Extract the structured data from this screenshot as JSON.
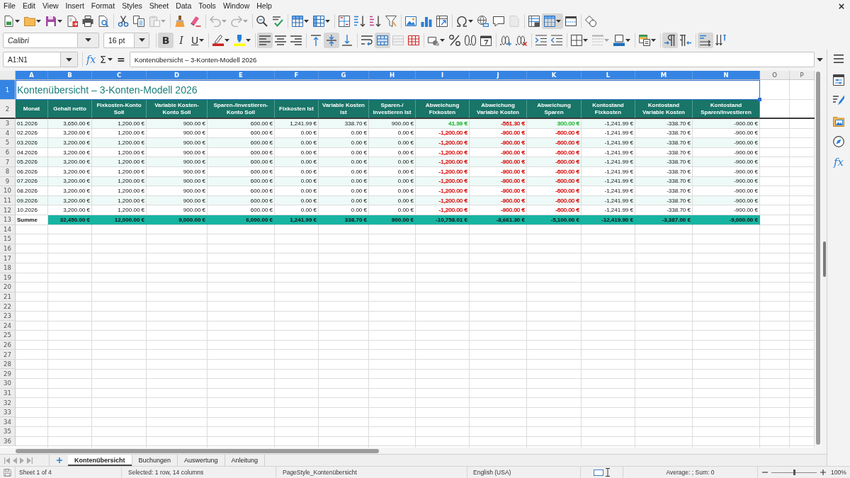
{
  "menu_bar": {
    "items": [
      "File",
      "Edit",
      "View",
      "Insert",
      "Format",
      "Styles",
      "Sheet",
      "Data",
      "Tools",
      "Window",
      "Help"
    ]
  },
  "standard_toolbar": {
    "buttons": [
      {
        "pressed": false,
        "disabled": false
      },
      {
        "pressed": false,
        "disabled": false
      },
      {
        "pressed": false,
        "disabled": false
      },
      {
        "pressed": false,
        "disabled": false
      },
      {
        "pressed": false,
        "disabled": false
      },
      {
        "pressed": false,
        "disabled": false
      },
      {
        "pressed": false,
        "disabled": false
      },
      {
        "pressed": false,
        "disabled": false
      },
      {
        "pressed": false,
        "disabled": true
      },
      {
        "pressed": false,
        "disabled": false
      },
      {
        "pressed": false,
        "disabled": false
      },
      {
        "pressed": false,
        "disabled": true
      },
      {
        "pressed": false,
        "disabled": true
      },
      {
        "pressed": false,
        "disabled": false
      },
      {
        "pressed": false,
        "disabled": false
      },
      {
        "pressed": false,
        "disabled": false
      },
      {
        "pressed": false,
        "disabled": false
      },
      {
        "pressed": false,
        "disabled": false
      },
      {
        "pressed": false,
        "disabled": false
      },
      {
        "pressed": false,
        "disabled": false
      },
      {
        "pressed": false,
        "disabled": false
      },
      {
        "pressed": false,
        "disabled": false
      },
      {
        "pressed": false,
        "disabled": false
      },
      {
        "pressed": false,
        "disabled": false
      },
      {
        "pressed": false,
        "disabled": false
      },
      {
        "pressed": false,
        "disabled": false
      },
      {
        "pressed": false,
        "disabled": false
      },
      {
        "pressed": false,
        "disabled": true
      },
      {
        "pressed": false,
        "disabled": false
      },
      {
        "pressed": true,
        "disabled": false
      },
      {
        "pressed": false,
        "disabled": false
      },
      {
        "pressed": false,
        "disabled": false
      }
    ]
  },
  "formatting_toolbar": {
    "font_name": "Calibri",
    "font_size": "16 pt",
    "buttons": [
      {
        "label": "B",
        "pressed": true,
        "disabled": false
      },
      {
        "label": "I",
        "pressed": false,
        "disabled": false
      },
      {
        "label": "U",
        "pressed": false,
        "disabled": false
      },
      {
        "pressed": false,
        "disabled": false
      },
      {
        "pressed": false,
        "disabled": false
      },
      {
        "pressed": true,
        "disabled": false
      },
      {
        "pressed": false,
        "disabled": false
      },
      {
        "pressed": false,
        "disabled": false
      },
      {
        "pressed": false,
        "disabled": false
      },
      {
        "pressed": true,
        "disabled": false
      },
      {
        "pressed": false,
        "disabled": false
      },
      {
        "pressed": false,
        "disabled": false
      },
      {
        "pressed": true,
        "disabled": false
      },
      {
        "pressed": false,
        "disabled": true
      },
      {
        "pressed": false,
        "disabled": false
      },
      {
        "pressed": false,
        "disabled": false
      },
      {
        "pressed": false,
        "disabled": false
      },
      {
        "pressed": false,
        "disabled": false
      },
      {
        "pressed": false,
        "disabled": false
      },
      {
        "pressed": false,
        "disabled": false
      },
      {
        "pressed": false,
        "disabled": false
      },
      {
        "pressed": false,
        "disabled": false
      },
      {
        "pressed": false,
        "disabled": false
      },
      {
        "pressed": false,
        "disabled": false
      },
      {
        "pressed": false,
        "disabled": true
      },
      {
        "pressed": false,
        "disabled": false
      },
      {
        "pressed": false,
        "disabled": false
      },
      {
        "pressed": true,
        "disabled": false
      },
      {
        "pressed": false,
        "disabled": false
      },
      {
        "pressed": true,
        "disabled": false
      },
      {
        "pressed": false,
        "disabled": false
      }
    ]
  },
  "formula_bar": {
    "name_box": "A1:N1",
    "function_wizard": "fx",
    "sum": "Σ",
    "formula": "=",
    "content": "Kontenübersicht – 3-Konten-Modell 2026"
  },
  "sheet": {
    "columns": [
      {
        "label": "A",
        "selected": true
      },
      {
        "label": "B",
        "selected": true
      },
      {
        "label": "C",
        "selected": true
      },
      {
        "label": "D",
        "selected": true
      },
      {
        "label": "E",
        "selected": true
      },
      {
        "label": "F",
        "selected": true
      },
      {
        "label": "G",
        "selected": true
      },
      {
        "label": "H",
        "selected": true
      },
      {
        "label": "I",
        "selected": true
      },
      {
        "label": "J",
        "selected": true
      },
      {
        "label": "K",
        "selected": true
      },
      {
        "label": "L",
        "selected": true
      },
      {
        "label": "M",
        "selected": true
      },
      {
        "label": "N",
        "selected": true
      },
      {
        "label": "O",
        "selected": false
      },
      {
        "label": "P",
        "selected": false
      }
    ],
    "rows": [
      {
        "label": "1",
        "selected": true
      },
      {
        "label": "2",
        "selected": false
      },
      {
        "label": "3",
        "selected": false
      },
      {
        "label": "4",
        "selected": false
      },
      {
        "label": "5",
        "selected": false
      },
      {
        "label": "6",
        "selected": false
      },
      {
        "label": "7",
        "selected": false
      },
      {
        "label": "8",
        "selected": false
      },
      {
        "label": "9",
        "selected": false
      },
      {
        "label": "10",
        "selected": false
      },
      {
        "label": "11",
        "selected": false
      },
      {
        "label": "12",
        "selected": false
      },
      {
        "label": "13",
        "selected": false
      },
      {
        "label": "14",
        "selected": false
      },
      {
        "label": "15",
        "selected": false
      },
      {
        "label": "16",
        "selected": false
      },
      {
        "label": "17",
        "selected": false
      },
      {
        "label": "18",
        "selected": false
      },
      {
        "label": "19",
        "selected": false
      },
      {
        "label": "20",
        "selected": false
      },
      {
        "label": "21",
        "selected": false
      },
      {
        "label": "22",
        "selected": false
      },
      {
        "label": "23",
        "selected": false
      },
      {
        "label": "24",
        "selected": false
      },
      {
        "label": "25",
        "selected": false
      },
      {
        "label": "26",
        "selected": false
      },
      {
        "label": "27",
        "selected": false
      },
      {
        "label": "28",
        "selected": false
      },
      {
        "label": "29",
        "selected": false
      },
      {
        "label": "30",
        "selected": false
      },
      {
        "label": "31",
        "selected": false
      },
      {
        "label": "32",
        "selected": false
      },
      {
        "label": "33",
        "selected": false
      },
      {
        "label": "34",
        "selected": false
      },
      {
        "label": "35",
        "selected": false
      },
      {
        "label": "36",
        "selected": false
      }
    ],
    "title": "Kontenübersicht – 3-Konten-Modell 2026",
    "headings": [
      "Monat",
      "Gehalt netto",
      "Fixkosten-Konto Soll",
      "Variable Kosten-Konto Soll",
      "Sparen-/Investieren-Konto Soll",
      "Fixkosten Ist",
      "Variable Kosten Ist",
      "Sparen-/Investieren Ist",
      "Abweichung Fixkosten",
      "Abweichung Variable Kosten",
      "Abweichung Sparen",
      "Kontostand Fixkosten",
      "Kontostand Variable Kosten",
      "Kontostand Sparen/Investieren"
    ],
    "data_rows": [
      [
        "01.2026",
        "3,650.00 €",
        "1,200.00 €",
        "900.00 €",
        "600.00 €",
        "1,241.99 €",
        "338.70 €",
        "900.00 €",
        {
          "text": "41.99 €",
          "color": "#33bb44"
        },
        {
          "text": "-561.30 €",
          "color": "#dd2222"
        },
        {
          "text": "300.00 €",
          "color": "#33bb44"
        },
        "-1,241.99 €",
        "-338.70 €",
        "-900.00 €"
      ],
      [
        "02.2026",
        "3,200.00 €",
        "1,200.00 €",
        "900.00 €",
        "600.00 €",
        "0.00 €",
        "0.00 €",
        "0.00 €",
        {
          "text": "-1,200.00 €",
          "color": "#dd2222"
        },
        {
          "text": "-900.00 €",
          "color": "#dd2222"
        },
        {
          "text": "-600.00 €",
          "color": "#dd2222"
        },
        "-1,241.99 €",
        "-338.70 €",
        "-900.00 €"
      ],
      [
        "03.2026",
        "3,200.00 €",
        "1,200.00 €",
        "900.00 €",
        "600.00 €",
        "0.00 €",
        "0.00 €",
        "0.00 €",
        {
          "text": "-1,200.00 €",
          "color": "#dd2222"
        },
        {
          "text": "-900.00 €",
          "color": "#dd2222"
        },
        {
          "text": "-600.00 €",
          "color": "#dd2222"
        },
        "-1,241.99 €",
        "-338.70 €",
        "-900.00 €"
      ],
      [
        "04.2026",
        "3,200.00 €",
        "1,200.00 €",
        "900.00 €",
        "600.00 €",
        "0.00 €",
        "0.00 €",
        "0.00 €",
        {
          "text": "-1,200.00 €",
          "color": "#dd2222"
        },
        {
          "text": "-900.00 €",
          "color": "#dd2222"
        },
        {
          "text": "-600.00 €",
          "color": "#dd2222"
        },
        "-1,241.99 €",
        "-338.70 €",
        "-900.00 €"
      ],
      [
        "05.2026",
        "3,200.00 €",
        "1,200.00 €",
        "900.00 €",
        "600.00 €",
        "0.00 €",
        "0.00 €",
        "0.00 €",
        {
          "text": "-1,200.00 €",
          "color": "#dd2222"
        },
        {
          "text": "-900.00 €",
          "color": "#dd2222"
        },
        {
          "text": "-600.00 €",
          "color": "#dd2222"
        },
        "-1,241.99 €",
        "-338.70 €",
        "-900.00 €"
      ],
      [
        "06.2026",
        "3,200.00 €",
        "1,200.00 €",
        "900.00 €",
        "600.00 €",
        "0.00 €",
        "0.00 €",
        "0.00 €",
        {
          "text": "-1,200.00 €",
          "color": "#dd2222"
        },
        {
          "text": "-900.00 €",
          "color": "#dd2222"
        },
        {
          "text": "-600.00 €",
          "color": "#dd2222"
        },
        "-1,241.99 €",
        "-338.70 €",
        "-900.00 €"
      ],
      [
        "07.2026",
        "3,200.00 €",
        "1,200.00 €",
        "900.00 €",
        "600.00 €",
        "0.00 €",
        "0.00 €",
        "0.00 €",
        {
          "text": "-1,200.00 €",
          "color": "#dd2222"
        },
        {
          "text": "-900.00 €",
          "color": "#dd2222"
        },
        {
          "text": "-600.00 €",
          "color": "#dd2222"
        },
        "-1,241.99 €",
        "-338.70 €",
        "-900.00 €"
      ],
      [
        "08.2026",
        "3,200.00 €",
        "1,200.00 €",
        "900.00 €",
        "600.00 €",
        "0.00 €",
        "0.00 €",
        "0.00 €",
        {
          "text": "-1,200.00 €",
          "color": "#dd2222"
        },
        {
          "text": "-900.00 €",
          "color": "#dd2222"
        },
        {
          "text": "-600.00 €",
          "color": "#dd2222"
        },
        "-1,241.99 €",
        "-338.70 €",
        "-900.00 €"
      ],
      [
        "09.2026",
        "3,200.00 €",
        "1,200.00 €",
        "900.00 €",
        "600.00 €",
        "0.00 €",
        "0.00 €",
        "0.00 €",
        {
          "text": "-1,200.00 €",
          "color": "#dd2222"
        },
        {
          "text": "-900.00 €",
          "color": "#dd2222"
        },
        {
          "text": "-600.00 €",
          "color": "#dd2222"
        },
        "-1,241.99 €",
        "-338.70 €",
        "-900.00 €"
      ],
      [
        "10.2026",
        "3,200.00 €",
        "1,200.00 €",
        "900.00 €",
        "600.00 €",
        "0.00 €",
        "0.00 €",
        "0.00 €",
        {
          "text": "-1,200.00 €",
          "color": "#dd2222"
        },
        {
          "text": "-900.00 €",
          "color": "#dd2222"
        },
        {
          "text": "-600.00 €",
          "color": "#dd2222"
        },
        "-1,241.99 €",
        "-338.70 €",
        "-900.00 €"
      ]
    ],
    "sum_row": [
      "Summe",
      "32,450.00 €",
      "12,000.00 €",
      "9,000.00 €",
      "6,000.00 €",
      "1,241.99 €",
      "338.70 €",
      "900.00 €",
      "-10,758.01 €",
      "-8,661.30 €",
      "-5,100.00 €",
      "-12,419.90 €",
      "-3,387.00 €",
      "-9,000.00 €"
    ]
  },
  "sheet_tabs": [
    {
      "label": "Kontenübersicht",
      "selected": true
    },
    {
      "label": "Buchungen",
      "selected": false
    },
    {
      "label": "Auswertung",
      "selected": false
    },
    {
      "label": "Anleitung",
      "selected": false
    }
  ],
  "sidebar": {
    "functions": "fx"
  },
  "status_bar": {
    "sheet": "Sheet 1 of 4",
    "selection": "Selected: 1 row, 14 columns",
    "page_style": "PageStyle_Kontenübersicht",
    "language": "English (USA)",
    "summary": "Average: ; Sum: 0",
    "zoom": {
      "level": 0.5,
      "reading": "100%"
    }
  }
}
